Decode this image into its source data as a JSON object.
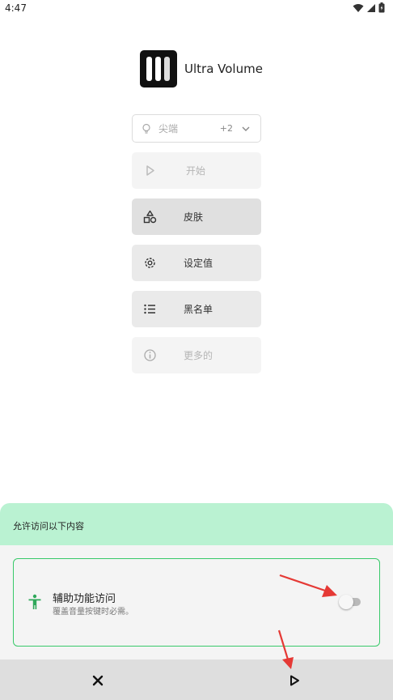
{
  "status_bar": {
    "time": "4:47",
    "icons": [
      "wifi-icon",
      "signal-icon",
      "battery-icon"
    ]
  },
  "app": {
    "title": "Ultra Volume"
  },
  "selector": {
    "label": "尖端",
    "count": "+2"
  },
  "menu": {
    "start": "开始",
    "skins": "皮肤",
    "settings": "设定值",
    "blacklist": "黑名单",
    "more": "更多的"
  },
  "permission_sheet": {
    "header": "允许访问以下内容",
    "item_title": "辅助功能访问",
    "item_desc": "覆盖音量按键时必需。",
    "toggle_on": false
  },
  "colors": {
    "accent_green": "#38c96a",
    "sheet_header_bg": "#baf2d2",
    "annotation_arrow": "#e53935"
  }
}
